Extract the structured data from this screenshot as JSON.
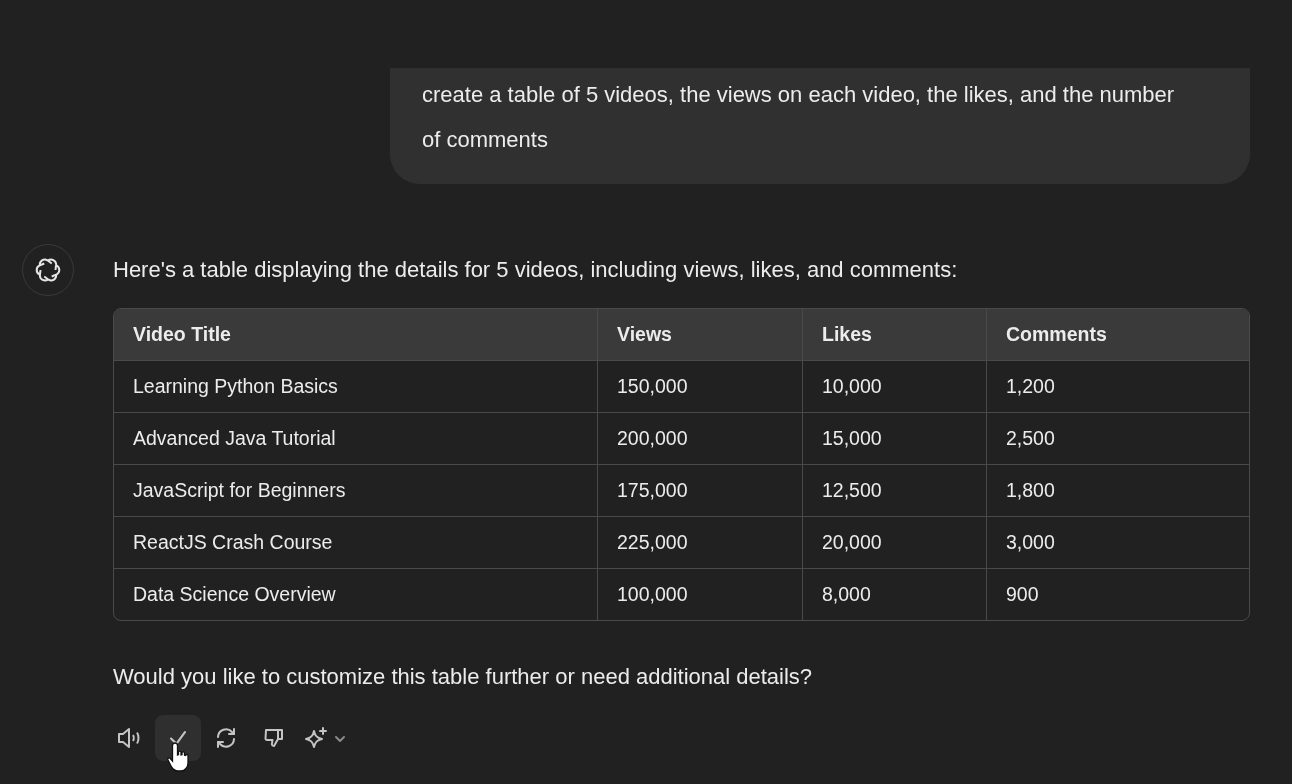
{
  "user_message": {
    "text": "create a table of 5 videos, the views on each video, the likes, and the number of comments"
  },
  "assistant": {
    "intro": "Here's a table displaying the details for 5 videos, including views, likes, and comments:",
    "table": {
      "columns": [
        "Video Title",
        "Views",
        "Likes",
        "Comments"
      ],
      "rows": [
        [
          "Learning Python Basics",
          "150,000",
          "10,000",
          "1,200"
        ],
        [
          "Advanced Java Tutorial",
          "200,000",
          "15,000",
          "2,500"
        ],
        [
          "JavaScript for Beginners",
          "175,000",
          "12,500",
          "1,800"
        ],
        [
          "ReactJS Crash Course",
          "225,000",
          "20,000",
          "3,000"
        ],
        [
          "Data Science Overview",
          "100,000",
          "8,000",
          "900"
        ]
      ]
    },
    "follow_up": "Would you like to customize this table further or need additional details?"
  },
  "toolbar": [
    {
      "kind": "speaker",
      "hovered": false
    },
    {
      "kind": "check",
      "hovered": true
    },
    {
      "kind": "refresh",
      "hovered": false
    },
    {
      "kind": "thumbs-down",
      "hovered": false
    },
    {
      "kind": "sparkle",
      "hovered": false
    }
  ]
}
